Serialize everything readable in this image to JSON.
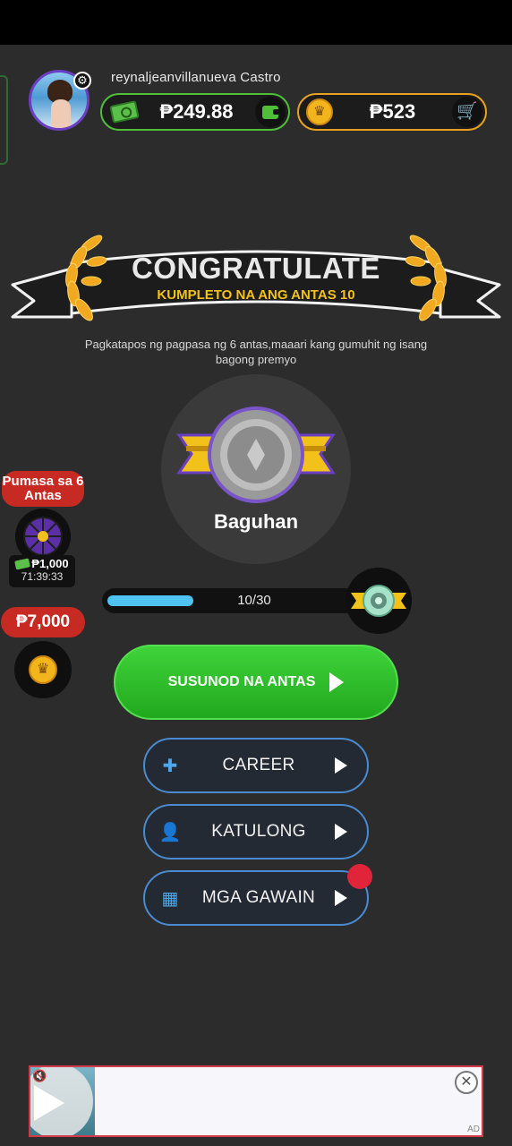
{
  "header": {
    "username": "reynaljeanvillanueva Castro",
    "cash_balance": "₱249.88",
    "coin_balance": "₱523",
    "settings_icon": "gear-icon",
    "cash_icon": "cash-icon",
    "wallet_icon": "wallet-icon",
    "coin_icon": "crown-coin-icon",
    "cart_icon": "cart-icon"
  },
  "banner": {
    "title": "CONGRATULATE",
    "subtitle": "KUMPLETO NA ANG ANTAS 10",
    "description": "Pagkatapos ng pagpasa ng  6  antas,maaari kang gumuhit ng isang bagong premyo"
  },
  "rank": {
    "name": "Baguhan"
  },
  "side": {
    "pumasa_label": "Pumasa sa 6 Antas",
    "wheel_reward": "₱1,000",
    "timer": "71:39:33",
    "crown_reward": "₱7,000"
  },
  "progress": {
    "label": "10/30",
    "current": 10,
    "total": 30
  },
  "buttons": {
    "next_level": "SUSUNOD NA ANTAS",
    "career": "CAREER",
    "katulong": "KATULONG",
    "mga_gawain": "MGA GAWAIN"
  },
  "ad": {
    "tag": "AD"
  },
  "colors": {
    "accent_green": "#21a81e",
    "accent_gold": "#f2c21a",
    "menu_border": "#4a8ad0",
    "badge_red": "#c62a22",
    "progress_fill": "#4fc3f2"
  }
}
